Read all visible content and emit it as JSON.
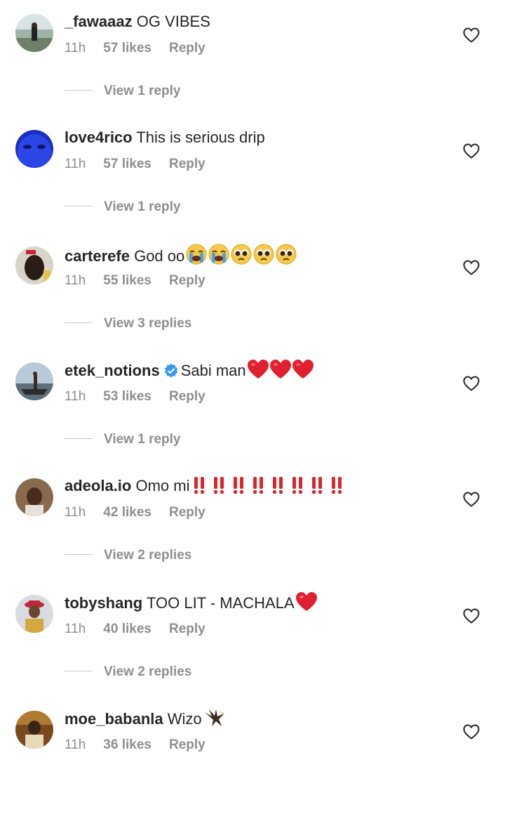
{
  "comments": [
    {
      "username": "_fawaaaz",
      "text": "OG VIBES",
      "time": "11h",
      "likes": "57 likes",
      "reply": "Reply",
      "view_replies": "View 1 reply",
      "avatar": "person-outdoor-photo",
      "emoji": []
    },
    {
      "username": "love4rico",
      "text": "This is serious drip",
      "time": "11h",
      "likes": "57 likes",
      "reply": "Reply",
      "view_replies": "View 1 reply",
      "avatar": "blue-face-photo",
      "emoji": []
    },
    {
      "username": "carterefe",
      "text": "God oo",
      "time": "11h",
      "likes": "55 likes",
      "reply": "Reply",
      "view_replies": "View 3 replies",
      "avatar": "man-face-photo",
      "emoji": [
        "crying-emoji",
        "crying-emoji",
        "pleading-emoji",
        "pleading-emoji",
        "pleading-emoji"
      ]
    },
    {
      "username": "etek_notions",
      "verified": true,
      "text": "Sabi man",
      "time": "11h",
      "likes": "53 likes",
      "reply": "Reply",
      "view_replies": "View 1 reply",
      "avatar": "boat-photo",
      "emoji": [
        "red-heart-emoji",
        "red-heart-emoji",
        "red-heart-emoji"
      ]
    },
    {
      "username": "adeola.io",
      "text": "Omo mi",
      "time": "11h",
      "likes": "42 likes",
      "reply": "Reply",
      "view_replies": "View 2 replies",
      "avatar": "portrait-photo",
      "emoji": [
        "double-exclamation-emoji",
        "double-exclamation-emoji",
        "double-exclamation-emoji",
        "double-exclamation-emoji",
        "double-exclamation-emoji",
        "double-exclamation-emoji",
        "double-exclamation-emoji",
        "double-exclamation-emoji"
      ]
    },
    {
      "username": "tobyshang",
      "text": "TOO LIT - MACHALA",
      "time": "11h",
      "likes": "40 likes",
      "reply": "Reply",
      "view_replies": "View 2 replies",
      "avatar": "man-red-hat-photo",
      "emoji": [
        "red-heart-emoji"
      ]
    },
    {
      "username": "moe_babanla",
      "text": "Wizo",
      "time": "11h",
      "likes": "36 likes",
      "reply": "Reply",
      "view_replies": "",
      "avatar": "gold-portrait-photo",
      "emoji": [
        "eagle-emoji"
      ]
    }
  ],
  "colors": {
    "text": "#262626",
    "muted": "#8e8e8e",
    "heart_emoji": "#e0202f",
    "exclamation_emoji": "#d8262c",
    "verified": "#3897f0"
  }
}
